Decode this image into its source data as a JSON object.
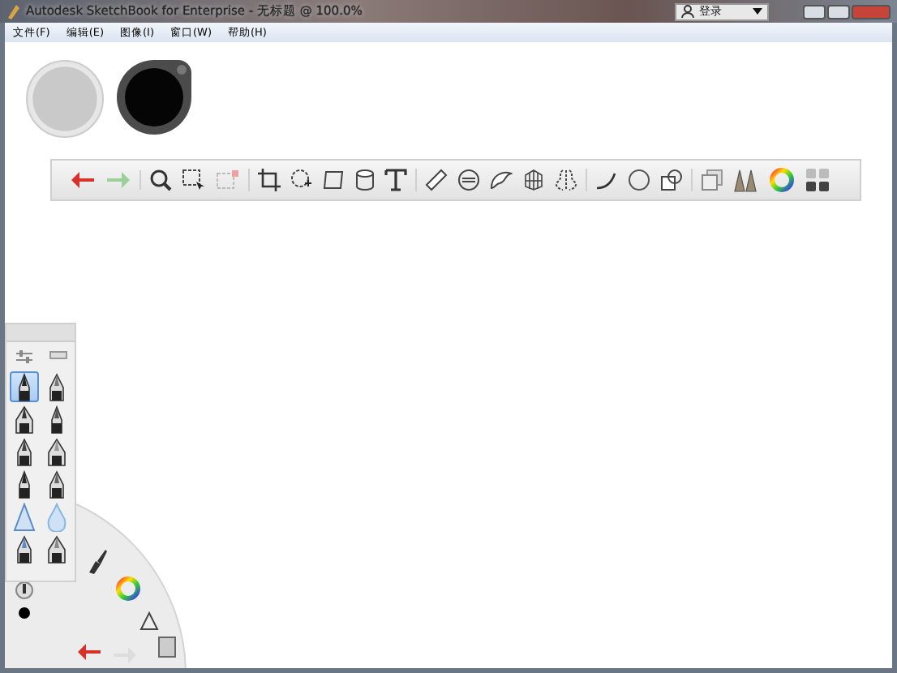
{
  "window": {
    "title": "Autodesk SketchBook for Enterprise - 无标题 @ 100.0%"
  },
  "account": {
    "label": "登录"
  },
  "menu": [
    "文件(F)",
    "编辑(E)",
    "图像(I)",
    "窗口(W)",
    "帮助(H)"
  ],
  "brushes": [
    {
      "selected": true
    },
    {
      "selected": false
    },
    {
      "selected": false
    },
    {
      "selected": false
    },
    {
      "selected": false
    },
    {
      "selected": false
    },
    {
      "selected": false
    },
    {
      "selected": false
    },
    {
      "selected": false
    },
    {
      "selected": false
    },
    {
      "selected": false
    },
    {
      "selected": false
    }
  ]
}
